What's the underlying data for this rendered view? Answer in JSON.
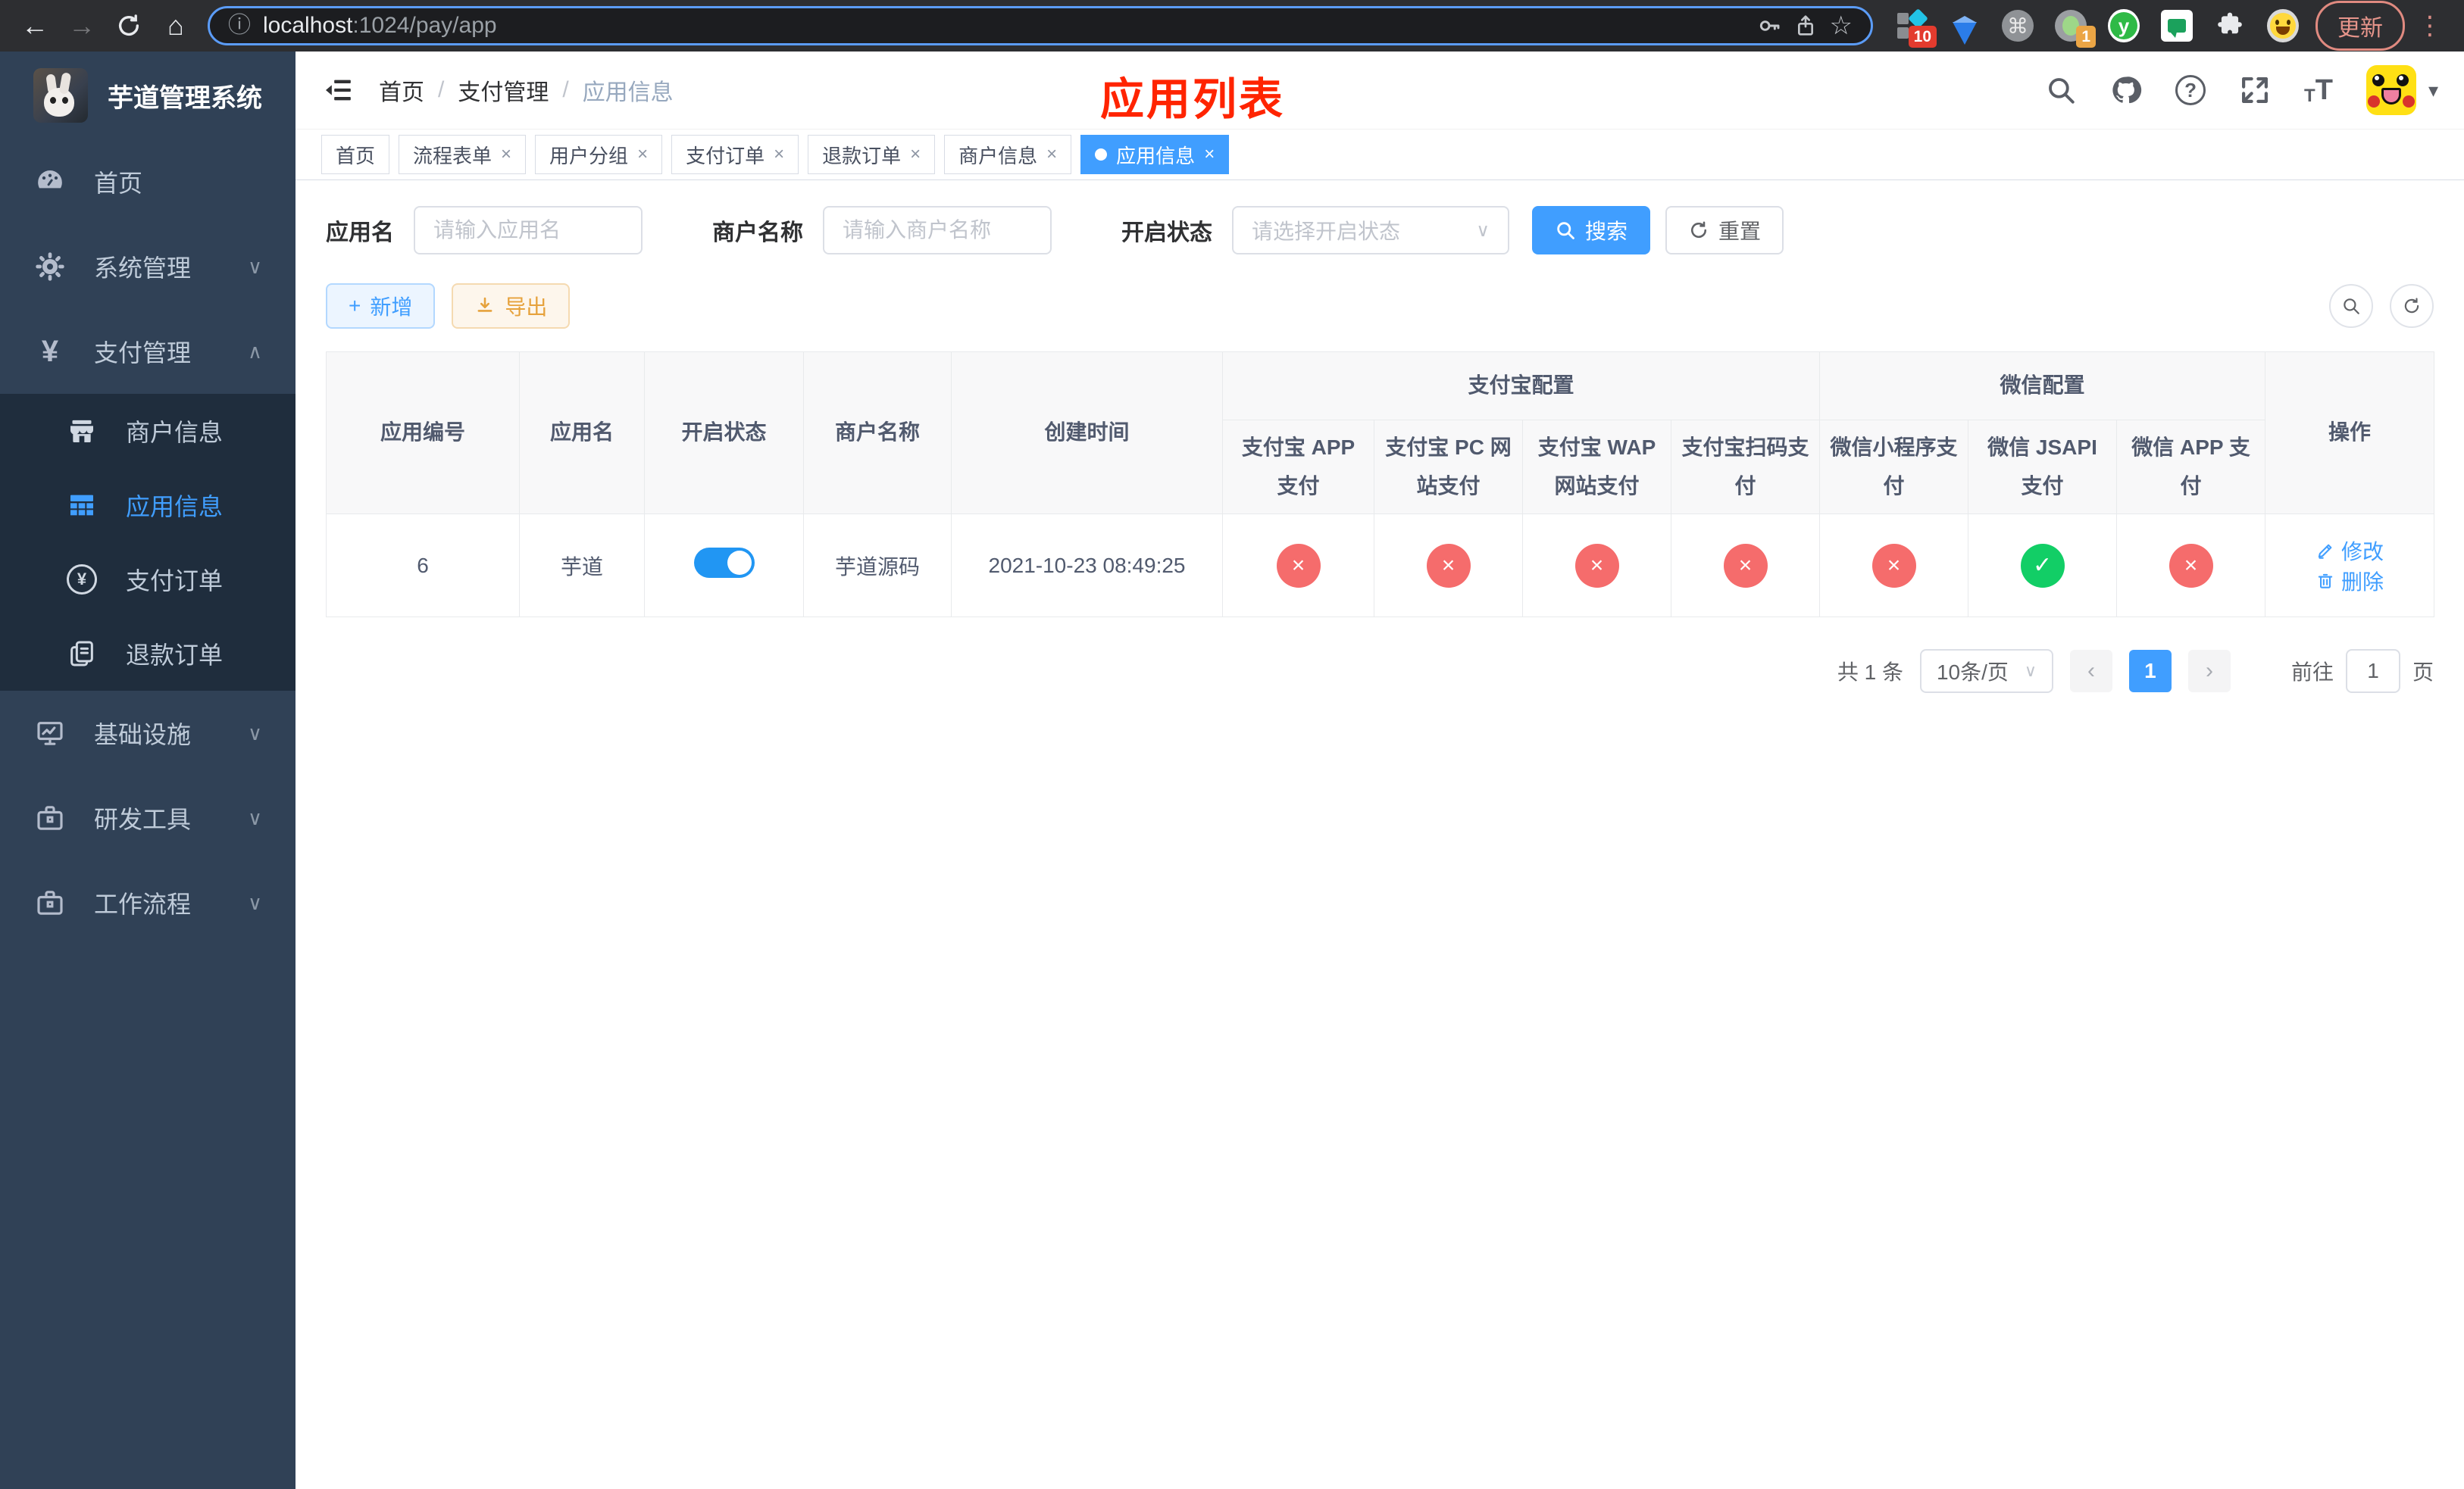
{
  "colors": {
    "accent": "#409eff",
    "success": "#12ce66",
    "danger": "#f56c6c",
    "warning": "#e6a23c",
    "annotation_red": "#ff2400"
  },
  "icons": {
    "back": "←",
    "forward": "→",
    "home": "⌂",
    "info": "ⓘ",
    "star": "☆",
    "command": "⌘",
    "close": "×",
    "check": "✓",
    "yen": "¥",
    "question": "?",
    "chevron_down": "∨",
    "chevron_up": "∧",
    "caret_down": "▾",
    "prev": "‹",
    "next": "›",
    "plus": "+",
    "kebab": "⋮",
    "ext_y": "y",
    "slash": "/",
    "t_small": "T",
    "t_large": "T"
  },
  "browser": {
    "url_host": "localhost",
    "url_path": ":1024/pay/app",
    "update_label": "更新",
    "ext_badge_grid": "10",
    "ext_badge_camera": "1"
  },
  "sidebar": {
    "title": "芋道管理系统",
    "home": "首页",
    "system": "系统管理",
    "payment": "支付管理",
    "merchant_info": "商户信息",
    "app_info": "应用信息",
    "pay_order": "支付订单",
    "refund_order": "退款订单",
    "infrastructure": "基础设施",
    "dev_tools": "研发工具",
    "workflow": "工作流程"
  },
  "breadcrumb": {
    "items": [
      "首页",
      "支付管理",
      "应用信息"
    ]
  },
  "annotation": {
    "page_title": "应用列表"
  },
  "tabs": [
    {
      "label": "首页"
    },
    {
      "label": "流程表单"
    },
    {
      "label": "用户分组"
    },
    {
      "label": "支付订单"
    },
    {
      "label": "退款订单"
    },
    {
      "label": "商户信息"
    },
    {
      "label": "应用信息"
    }
  ],
  "search": {
    "app_name_label": "应用名",
    "app_name_placeholder": "请输入应用名",
    "merchant_label": "商户名称",
    "merchant_placeholder": "请输入商户名称",
    "status_label": "开启状态",
    "status_placeholder": "请选择开启状态",
    "search_label": "搜索",
    "reset_label": "重置"
  },
  "toolbar": {
    "add_label": "新增",
    "export_label": "导出"
  },
  "table": {
    "headers": {
      "app_id": "应用编号",
      "app_name": "应用名",
      "status": "开启状态",
      "merchant": "商户名称",
      "created": "创建时间",
      "alipay_group": "支付宝配置",
      "wechat_group": "微信配置",
      "alipay_app": "支付宝 APP 支付",
      "alipay_pc": "支付宝 PC 网站支付",
      "alipay_wap": "支付宝 WAP 网站支付",
      "alipay_qr": "支付宝扫码支付",
      "wx_mini": "微信小程序支付",
      "wx_jsapi": "微信 JSAPI 支付",
      "wx_app": "微信 APP 支付",
      "actions": "操作"
    },
    "row": {
      "app_id": "6",
      "app_name": "芋道",
      "status_on": true,
      "status_cls": "switch on",
      "merchant": "芋道源码",
      "created": "2021-10-23 08:49:25",
      "channels": [
        {
          "name": "alipay-app-pay",
          "enabled": false,
          "glyph": "×",
          "cls": "cell-circle red"
        },
        {
          "name": "alipay-pc-pay",
          "enabled": false,
          "glyph": "×",
          "cls": "cell-circle red"
        },
        {
          "name": "alipay-wap-pay",
          "enabled": false,
          "glyph": "×",
          "cls": "cell-circle red"
        },
        {
          "name": "alipay-qr-pay",
          "enabled": false,
          "glyph": "×",
          "cls": "cell-circle red"
        },
        {
          "name": "wechat-mini-pay",
          "enabled": false,
          "glyph": "×",
          "cls": "cell-circle red"
        },
        {
          "name": "wechat-jsapi-pay",
          "enabled": true,
          "glyph": "✓",
          "cls": "cell-circle green"
        },
        {
          "name": "wechat-app-pay",
          "enabled": false,
          "glyph": "×",
          "cls": "cell-circle red"
        }
      ],
      "edit_label": "修改",
      "delete_label": "删除"
    }
  },
  "pagination": {
    "total": "共 1 条",
    "page_size": "10条/页",
    "current_page": "1",
    "goto_label": "前往",
    "goto_value": "1",
    "page_unit": "页"
  }
}
